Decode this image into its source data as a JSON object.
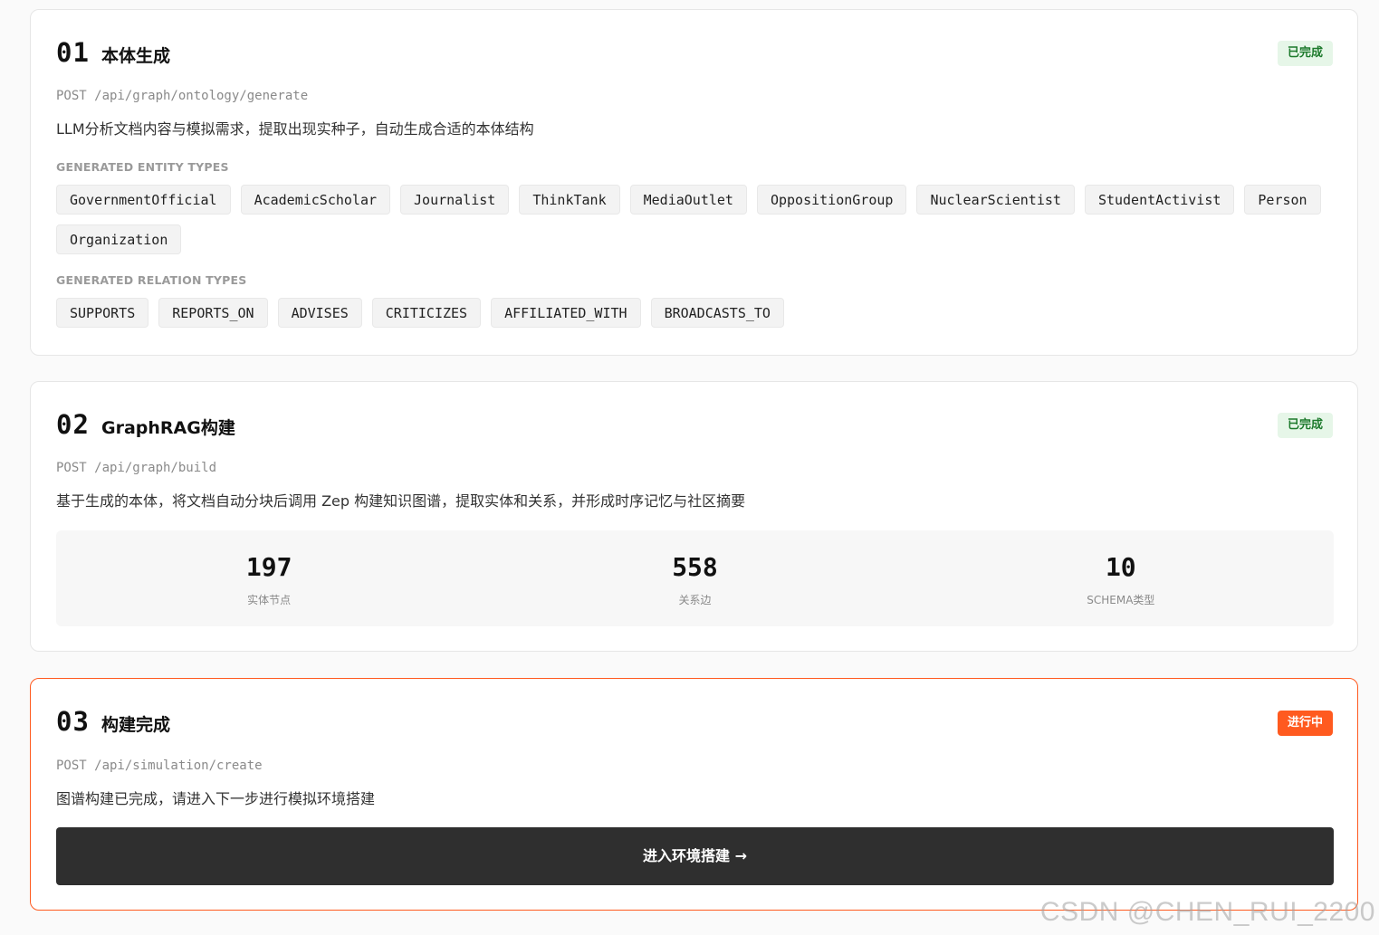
{
  "steps": [
    {
      "number": "01",
      "title": "本体生成",
      "status": "已完成",
      "endpoint": "POST /api/graph/ontology/generate",
      "description": "LLM分析文档内容与模拟需求，提取出现实种子，自动生成合适的本体结构",
      "entity_types_label": "GENERATED ENTITY TYPES",
      "entity_types": [
        "GovernmentOfficial",
        "AcademicScholar",
        "Journalist",
        "ThinkTank",
        "MediaOutlet",
        "OppositionGroup",
        "NuclearScientist",
        "StudentActivist",
        "Person",
        "Organization"
      ],
      "relation_types_label": "GENERATED RELATION TYPES",
      "relation_types": [
        "SUPPORTS",
        "REPORTS_ON",
        "ADVISES",
        "CRITICIZES",
        "AFFILIATED_WITH",
        "BROADCASTS_TO"
      ]
    },
    {
      "number": "02",
      "title": "GraphRAG构建",
      "status": "已完成",
      "endpoint": "POST /api/graph/build",
      "description": "基于生成的本体，将文档自动分块后调用 Zep 构建知识图谱，提取实体和关系，并形成时序记忆与社区摘要",
      "stats": [
        {
          "value": "197",
          "label": "实体节点"
        },
        {
          "value": "558",
          "label": "关系边"
        },
        {
          "value": "10",
          "label": "SCHEMA类型"
        }
      ]
    },
    {
      "number": "03",
      "title": "构建完成",
      "status": "进行中",
      "endpoint": "POST /api/simulation/create",
      "description": "图谱构建已完成，请进入下一步进行模拟环境搭建",
      "button_label": "进入环境搭建 →"
    }
  ],
  "watermark": "CSDN @CHEN_RUI_2200",
  "colors": {
    "accent": "#ff5a1f",
    "done_badge_bg": "#e6f6e8",
    "done_badge_text": "#1d7a2c",
    "button_bg": "#2f2f2f"
  }
}
